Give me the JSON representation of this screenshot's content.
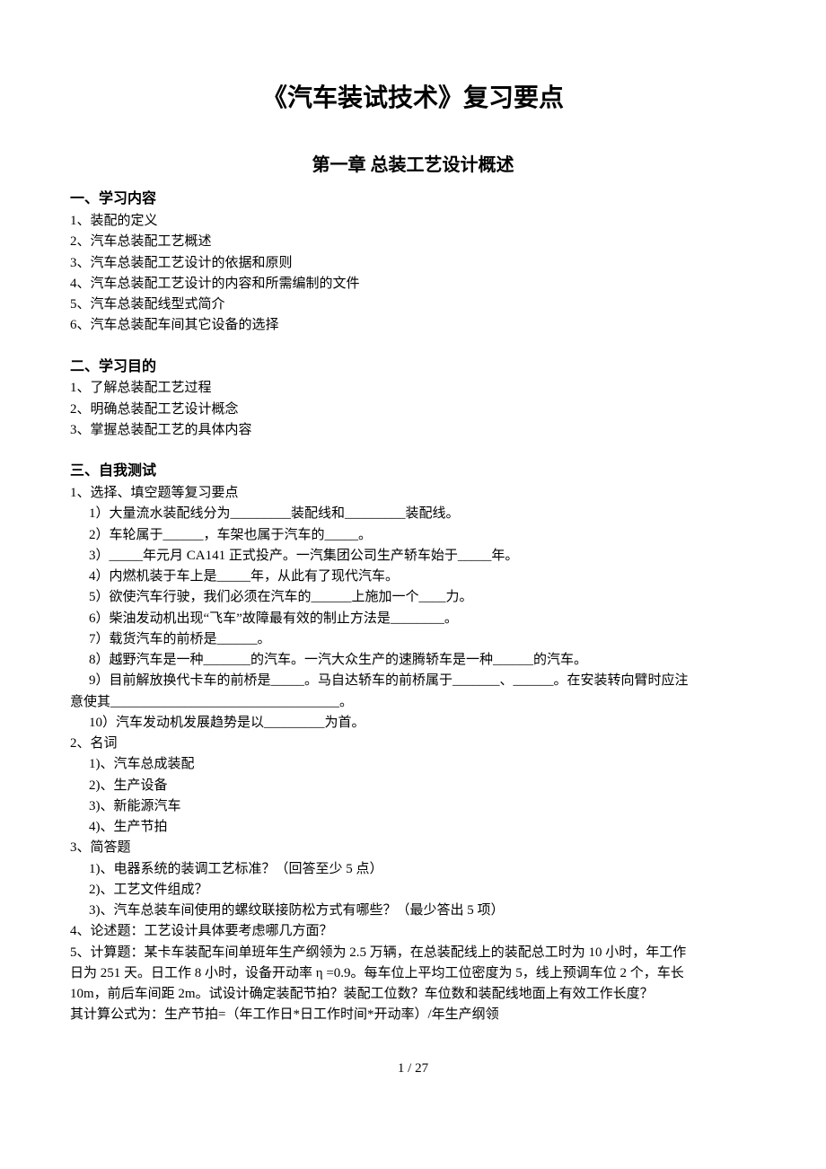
{
  "title": "《汽车装试技术》复习要点",
  "chapter": "第一章  总装工艺设计概述",
  "sections": {
    "s1": {
      "head": "一、学习内容",
      "items": [
        "1、装配的定义",
        "2、汽车总装配工艺概述",
        "3、汽车总装配工艺设计的依据和原则",
        "4、汽车总装配工艺设计的内容和所需编制的文件",
        "5、汽车总装配线型式简介",
        "6、汽车总装配车间其它设备的选择"
      ]
    },
    "s2": {
      "head": "二、学习目的",
      "items": [
        "1、了解总装配工艺过程",
        "2、明确总装配工艺设计概念",
        "3、掌握总装配工艺的具体内容"
      ]
    },
    "s3": {
      "head": "三、自我测试",
      "items": {
        "q1head": "1、选择、填空题等复习要点",
        "q1_1": "1）大量流水装配线分为_________装配线和_________装配线。",
        "q1_2": "2）车轮属于______，车架也属于汽车的_____。",
        "q1_3": "3）_____年元月 CA141 正式投产。一汽集团公司生产轿车始于_____年。",
        "q1_4": "4）内燃机装于车上是_____年，从此有了现代汽车。",
        "q1_5": "5）欲使汽车行驶，我们必须在汽车的______上施加一个____力。",
        "q1_6": "6）柴油发动机出现“飞车”故障最有效的制止方法是________。",
        "q1_7": "7）载货汽车的前桥是______。",
        "q1_8": "8）越野汽车是一种_______的汽车。一汽大众生产的速腾轿车是一种______的汽车。",
        "q1_9a": "9）目前解放换代卡车的前桥是_____。马自达轿车的前桥属于_______、______。在安装转向臂时应注",
        "q1_9b": "意使其__________________________________。",
        "q1_10": "10）汽车发动机发展趋势是以_________为首。",
        "q2head": "2、名词",
        "q2_1": "1)、汽车总成装配",
        "q2_2": "2)、生产设备",
        "q2_3": "3)、新能源汽车",
        "q2_4": "4)、生产节拍",
        "q3head": "3、简答题",
        "q3_1": "1)、电器系统的装调工艺标准？（回答至少 5 点）",
        "q3_2": "2)、工艺文件组成？",
        "q3_3": "3)、汽车总装车间使用的螺纹联接防松方式有哪些？（最少答出 5 项）",
        "q4": "4、论述题：工艺设计具体要考虑哪几方面？",
        "q5a": "5、计算题：某卡车装配车间单班年生产纲领为 2.5 万辆，在总装配线上的装配总工时为 10 小时，年工作",
        "q5b": "日为 251 天。日工作 8 小时，设备开动率 η =0.9。每车位上平均工位密度为 5，线上预调车位 2 个，车长",
        "q5c": "10m，前后车间距 2m。试设计确定装配节拍？装配工位数？车位数和装配线地面上有效工作长度？",
        "q5d": "其计算公式为：生产节拍=（年工作日*日工作时间*开动率）/年生产纲领"
      }
    }
  },
  "footer": "1  / 27"
}
